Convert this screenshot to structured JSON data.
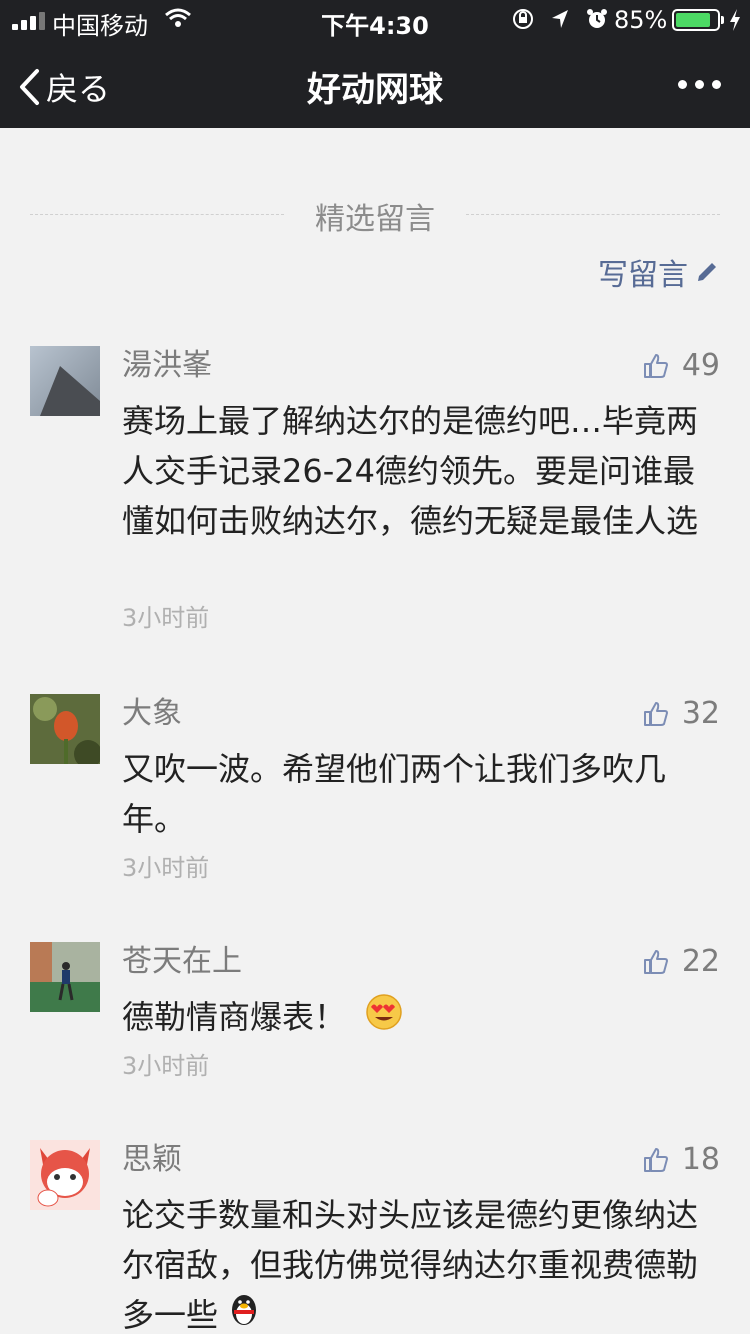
{
  "status": {
    "carrier": "中国移动",
    "time": "下午4:30",
    "battery": "85%",
    "battery_level": 0.85
  },
  "nav": {
    "back_label": "戻る",
    "title": "好动网球"
  },
  "section": {
    "title": "精选留言",
    "write_label": "写留言"
  },
  "colors": {
    "nav_bg": "#202124",
    "page_bg": "#f2f2f2",
    "link": "#576b95",
    "battery": "#4cd964"
  },
  "comments": [
    {
      "name": "湯洪峯",
      "likes": "49",
      "text": "赛场上最了解纳达尔的是德约吧…毕竟两人交手记录26-24德约领先。要是问谁最懂如何击败纳达尔，德约无疑是最佳人选",
      "time": "3小时前"
    },
    {
      "name": "大象",
      "likes": "32",
      "text": "又吹一波。希望他们两个让我们多吹几年。",
      "time": "3小时前"
    },
    {
      "name": "苍天在上",
      "likes": "22",
      "text": "德勒情商爆表！",
      "time": "3小时前"
    },
    {
      "name": "思颖",
      "likes": "18",
      "text": "论交手数量和头对头应该是德约更像纳达尔宿敌，但我仿佛觉得纳达尔重视费德勒多一些",
      "time": ""
    }
  ]
}
